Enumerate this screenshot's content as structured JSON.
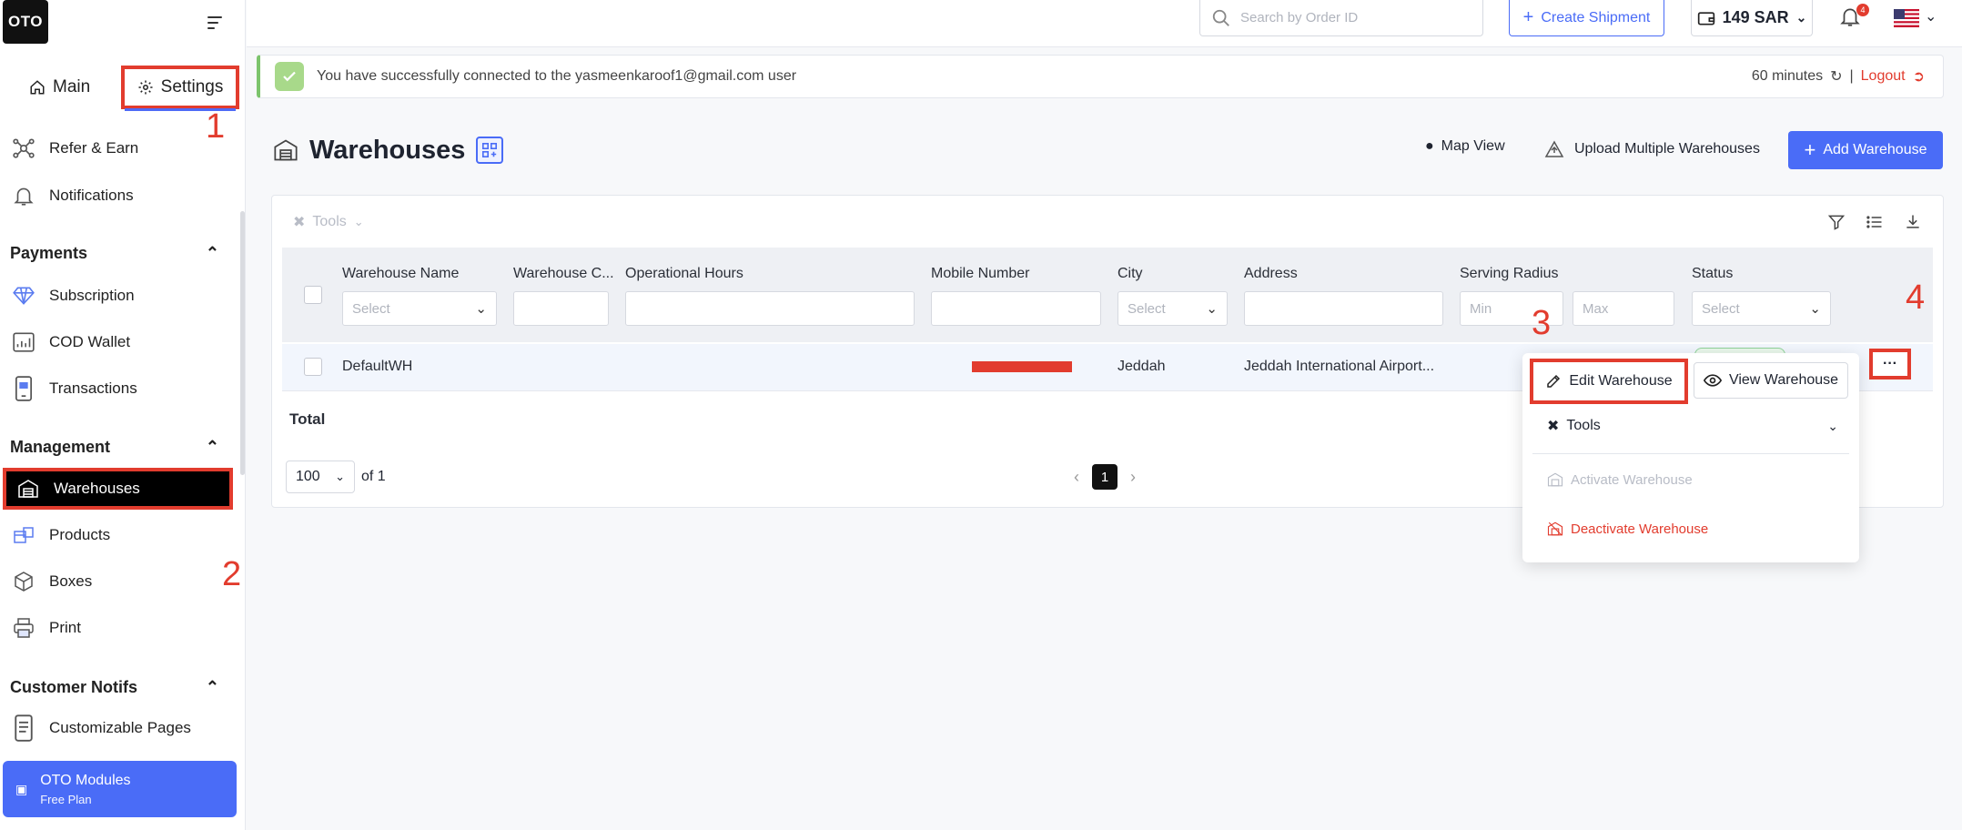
{
  "app": {
    "logo": "OTO"
  },
  "sidebar": {
    "tabs": [
      {
        "label": "Main"
      },
      {
        "label": "Settings"
      }
    ],
    "top_items": [
      {
        "label": "Refer & Earn",
        "icon": "network-icon"
      },
      {
        "label": "Notifications",
        "icon": "bell-icon"
      }
    ],
    "sections": [
      {
        "title": "Payments",
        "items": [
          {
            "label": "Subscription",
            "icon": "diamond-icon"
          },
          {
            "label": "COD Wallet",
            "icon": "wallet-chart-icon"
          },
          {
            "label": "Transactions",
            "icon": "phone-card-icon"
          }
        ]
      },
      {
        "title": "Management",
        "items": [
          {
            "label": "Warehouses",
            "icon": "warehouse-icon"
          },
          {
            "label": "Products",
            "icon": "products-icon"
          },
          {
            "label": "Boxes",
            "icon": "box-icon"
          },
          {
            "label": "Print",
            "icon": "printer-icon"
          }
        ]
      },
      {
        "title": "Customer Notifs",
        "items": [
          {
            "label": "Customizable Pages",
            "icon": "mobile-page-icon"
          }
        ]
      }
    ],
    "modules": {
      "title": "OTO Modules",
      "subtitle": "Free Plan"
    }
  },
  "annotations": {
    "n1": "1",
    "n2": "2",
    "n3": "3",
    "n4": "4"
  },
  "header": {
    "search_placeholder": "Search by Order ID",
    "create_label": "Create Shipment",
    "wallet_value": "149 SAR",
    "notif_count": "4"
  },
  "banner": {
    "message": "You have successfully connected to the yasmeenkaroof1@gmail.com user",
    "timer": "60 minutes",
    "separator": "|",
    "logout": "Logout"
  },
  "page": {
    "title": "Warehouses",
    "map_view": "Map View",
    "upload": "Upload Multiple Warehouses",
    "add": "Add Warehouse"
  },
  "table": {
    "tools_label": "Tools",
    "columns": [
      "Warehouse Name",
      "Warehouse C...",
      "Operational Hours",
      "Mobile Number",
      "City",
      "Address",
      "Serving Radius",
      "Status"
    ],
    "filters": {
      "select": "Select",
      "min": "Min",
      "max": "Max"
    },
    "row": {
      "name": "DefaultWH",
      "city": "Jeddah",
      "address": "Jeddah International Airport..."
    },
    "total_label": "Total",
    "per_page": "100",
    "of_pages": "of 1",
    "current_page": "1"
  },
  "menu": {
    "edit": "Edit Warehouse",
    "view": "View Warehouse",
    "tools": "Tools",
    "activate": "Activate Warehouse",
    "deactivate": "Deactivate Warehouse"
  },
  "colors": {
    "accent": "#4a6cf7",
    "annotation": "#e23c2e",
    "success": "#7cc46c"
  }
}
